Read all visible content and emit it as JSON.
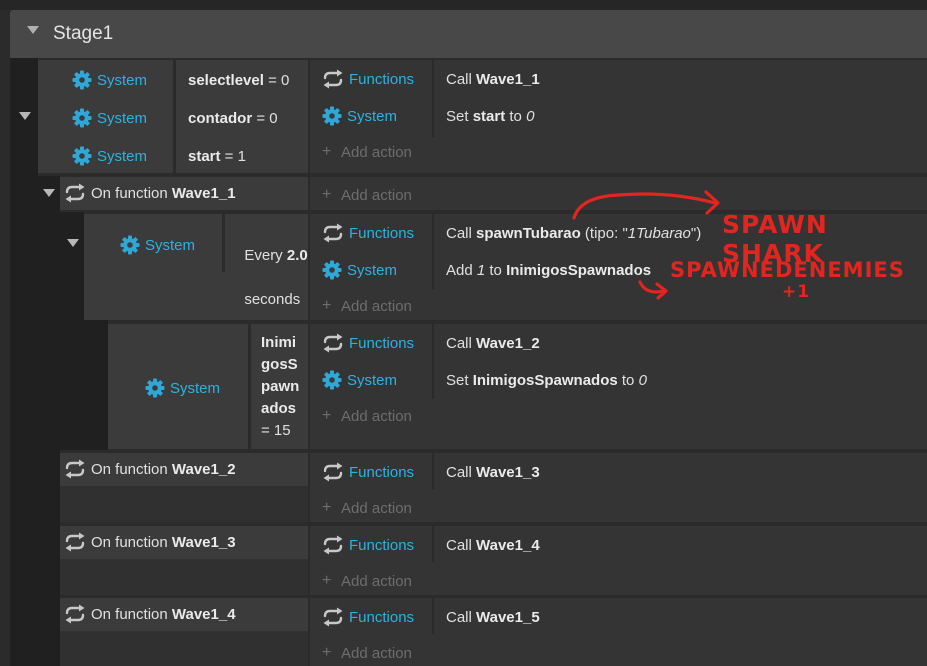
{
  "group": {
    "title": "Stage1"
  },
  "block0": {
    "conditions": [
      {
        "object": "System",
        "var": "selectlevel",
        "rest": " = 0"
      },
      {
        "object": "System",
        "var": "contador",
        "rest": " = 0"
      },
      {
        "object": "System",
        "var": "start",
        "rest": " = 1"
      }
    ],
    "actions": [
      {
        "object": "Functions",
        "pre": "Call ",
        "bold": "Wave1_1"
      },
      {
        "object": "System",
        "pre": "Set ",
        "bold": "start",
        "mid": " to ",
        "ital": "0"
      }
    ],
    "add_action": "Add action"
  },
  "block1": {
    "pre": "On function ",
    "bold": "Wave1_1",
    "add_action": "Add action",
    "sub1": {
      "object": "System",
      "every_pre": "Every ",
      "every_bold": "2.0",
      "every_post": "seconds",
      "actions": [
        {
          "object": "Functions",
          "pre": "Call ",
          "bold": "spawnTubarao",
          "args_pre": " (tipo: \"",
          "args_ital": "1Tubarao",
          "args_post": "\")"
        },
        {
          "object": "System",
          "pre": "Add ",
          "ital": "1",
          "mid": " to ",
          "bold": "InimigosSpawnados"
        }
      ],
      "add_action": "Add action"
    },
    "sub2": {
      "object": "System",
      "var_lines": [
        "Inimi",
        "gosS",
        "pawn",
        "ados"
      ],
      "var_tail": "= 15",
      "actions": [
        {
          "object": "Functions",
          "pre": "Call ",
          "bold": "Wave1_2"
        },
        {
          "object": "System",
          "pre": "Set ",
          "bold": "InimigosSpawnados",
          "mid": " to ",
          "ital": "0"
        }
      ],
      "add_action": "Add action"
    }
  },
  "block2": {
    "pre": "On function ",
    "bold": "Wave1_2",
    "action_object": "Functions",
    "action_pre": "Call ",
    "action_bold": "Wave1_3",
    "add_action": "Add action"
  },
  "block3": {
    "pre": "On function ",
    "bold": "Wave1_3",
    "action_object": "Functions",
    "action_pre": "Call ",
    "action_bold": "Wave1_4",
    "add_action": "Add action"
  },
  "block4": {
    "pre": "On function ",
    "bold": "Wave1_4",
    "action_object": "Functions",
    "action_pre": "Call ",
    "action_bold": "Wave1_5",
    "add_action": "Add action"
  },
  "annotations": {
    "spawn_shark": "SPAWN SHARK",
    "spawned_enemies": "SPAWNEDENEMIES",
    "plus_one": "+1"
  },
  "colors": {
    "accent": "#29b3e3",
    "annotation": "#e2261f"
  }
}
